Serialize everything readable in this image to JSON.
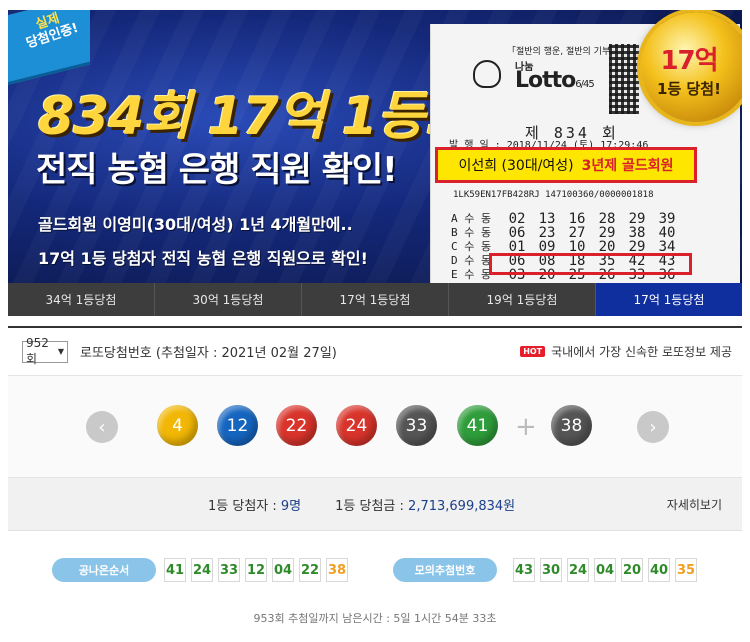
{
  "banner": {
    "cert_badge": [
      "실제",
      "당첨인증!"
    ],
    "headline": "834회 17억 1등!",
    "subhead": "전직 농협 은행 직원 확인!",
    "desc1": "골드회원 이영미(30대/여성) 1년 4개월만에..",
    "desc2": "17억 1등 당첨자 전직 농협 은행 직원으로 확인!",
    "medal_amount": "17억",
    "medal_sub": "1등 당첨!",
    "ticket": {
      "slogan": "「절반의 행운, 절반의 기부」",
      "logo_sub": "나눔",
      "logo": "Lotto",
      "logo_suffix": "6/45",
      "round": "제 834 회",
      "issue": "발 행 일 : 2018/11/24 (토) 17:29:46",
      "serial": "1LK59EN17FB428RJ    147100360/0000001818",
      "winner_name": "이선희 (30대/여성)",
      "winner_grade": "3년제 골드회원",
      "rows": [
        {
          "label": "A 수 동",
          "nums": [
            "02",
            "13",
            "16",
            "28",
            "29",
            "39"
          ]
        },
        {
          "label": "B 수 동",
          "nums": [
            "06",
            "23",
            "27",
            "29",
            "38",
            "40"
          ]
        },
        {
          "label": "C 수 동",
          "nums": [
            "01",
            "09",
            "10",
            "20",
            "29",
            "34"
          ]
        },
        {
          "label": "D 수 동",
          "nums": [
            "06",
            "08",
            "18",
            "35",
            "42",
            "43"
          ]
        },
        {
          "label": "E 수 동",
          "nums": [
            "03",
            "20",
            "25",
            "26",
            "33",
            "36"
          ]
        }
      ]
    }
  },
  "tabs": [
    {
      "label": "34억 1등당첨",
      "active": false
    },
    {
      "label": "30억 1등당첨",
      "active": false
    },
    {
      "label": "17억 1등당첨",
      "active": false
    },
    {
      "label": "19억 1등당첨",
      "active": false
    },
    {
      "label": "17억 1등당첨",
      "active": true
    }
  ],
  "draw": {
    "selected_round": "952회",
    "title": "로또당첨번호",
    "date_text": "(추첨일자 : 2021년 02월 27일)",
    "hot_badge": "HOT",
    "hot_text": "국내에서 가장 신속한 로또정보 제공"
  },
  "balls": [
    {
      "num": "4",
      "color": "#f2b705"
    },
    {
      "num": "12",
      "color": "#1565c0"
    },
    {
      "num": "22",
      "color": "#d9342b"
    },
    {
      "num": "24",
      "color": "#d9342b"
    },
    {
      "num": "33",
      "color": "#555555"
    },
    {
      "num": "41",
      "color": "#2e9d3a"
    }
  ],
  "bonus": {
    "num": "38",
    "color": "#555555"
  },
  "nav": {
    "prev": "‹",
    "next": "›",
    "plus": "+"
  },
  "stats": {
    "winners_label": "1등 당첨자 :",
    "winners_value": "9명",
    "prize_label": "1등 당첨금 :",
    "prize_value": "2,713,699,834원",
    "detail": "자세히보기"
  },
  "bottom": {
    "order_label": "공나온순서",
    "order_nums": [
      "41",
      "24",
      "33",
      "12",
      "04",
      "22"
    ],
    "order_bonus": "38",
    "sim_label": "모의추첨번호",
    "sim_nums": [
      "43",
      "30",
      "24",
      "04",
      "20",
      "40"
    ],
    "sim_bonus": "35",
    "countdown": "953회 추첨일까지 남은시간 : 5일 1시간 54분 33초"
  }
}
